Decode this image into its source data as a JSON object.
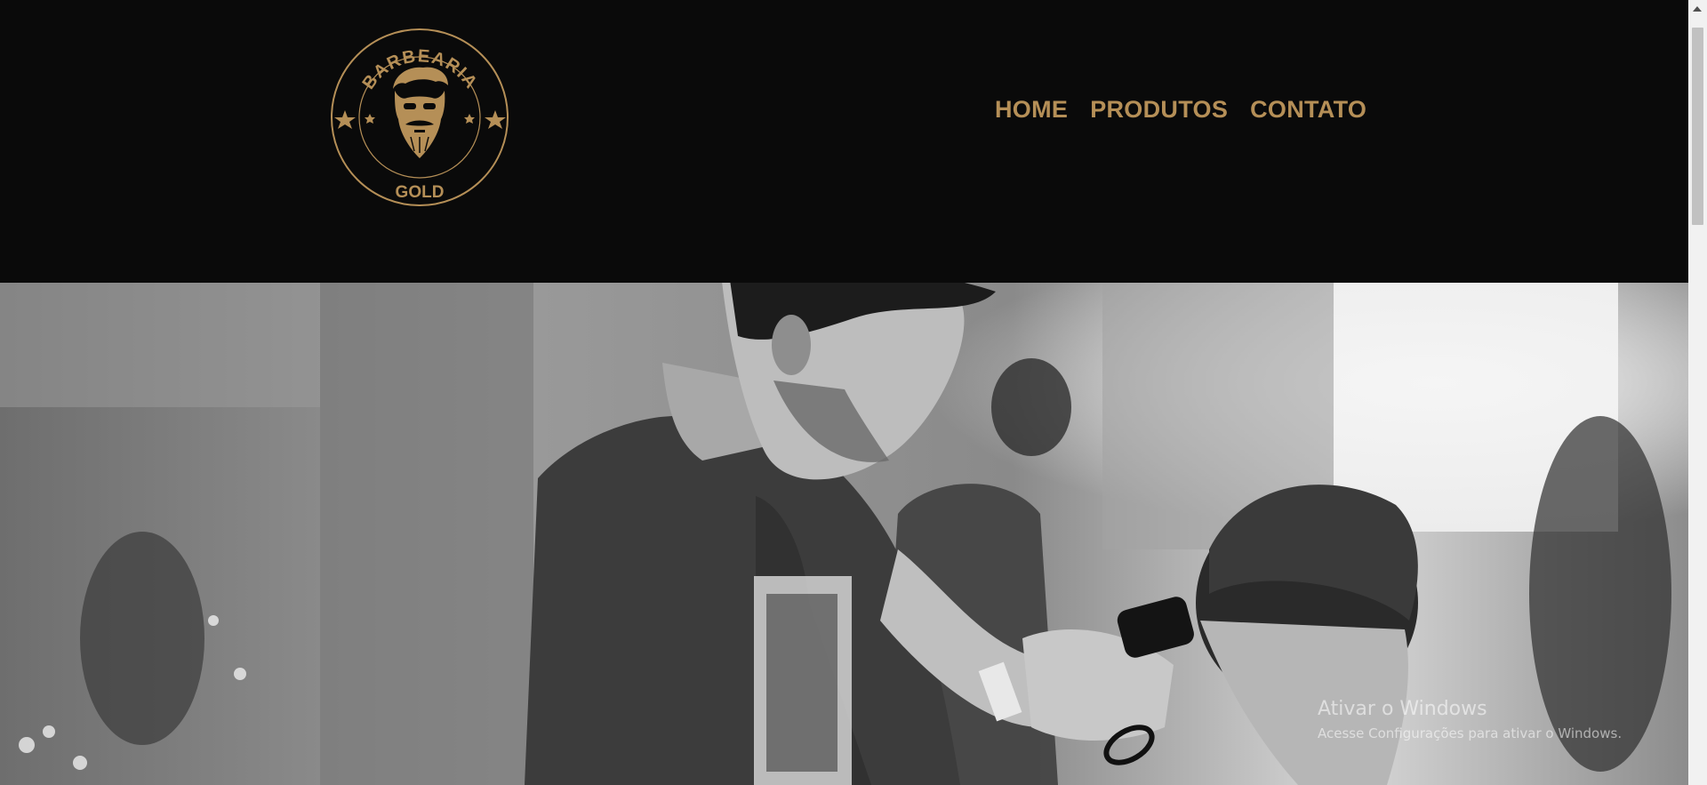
{
  "header": {
    "logo": {
      "top_text": "BARBEARIA",
      "bottom_text": "GOLD",
      "icon": "bearded-man-icon",
      "color": "#b58f57"
    },
    "nav": [
      {
        "label": "HOME"
      },
      {
        "label": "PRODUTOS"
      },
      {
        "label": "CONTATO"
      }
    ]
  },
  "hero": {
    "image": "barber-cutting-hair-photo"
  },
  "watermark": {
    "title": "Ativar o Windows",
    "subtitle": "Acesse Configurações para ativar o Windows."
  },
  "colors": {
    "background": "#0a0a0a",
    "accent": "#b58f57"
  }
}
